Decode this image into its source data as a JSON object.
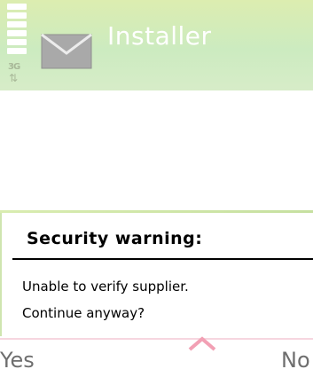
{
  "title_bar": {
    "app_title": "Installer",
    "network_type": "3G",
    "signal_level": 1.0,
    "icon": "envelope-icon"
  },
  "dialog": {
    "heading": "Security warning:",
    "message_line1": "Unable to verify supplier.",
    "message_line2": "Continue anyway?"
  },
  "softkeys": {
    "left": "Yes",
    "right": "No",
    "scroll_icon": "chevron-up-icon"
  },
  "colors": {
    "title_bg": "#cfe9b8",
    "title_text": "#ffffff",
    "softkey_text": "#6e6e6e",
    "scroll_accent": "#f2a0b4"
  }
}
